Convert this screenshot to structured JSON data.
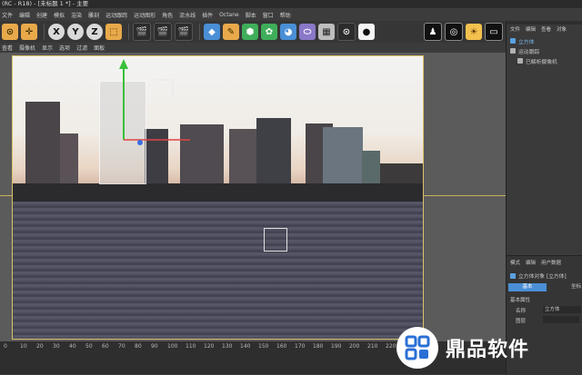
{
  "window": {
    "title": "(RC - R18) - [未标题 1 *] - 主要"
  },
  "menu": {
    "items": [
      "文件",
      "编辑",
      "创建",
      "模拟",
      "渲染",
      "雕刻",
      "运动跟踪",
      "运动图形",
      "角色",
      "流水线",
      "插件",
      "Octane",
      "脚本",
      "窗口",
      "帮助"
    ]
  },
  "toolbar": {
    "axes": [
      "X",
      "Y",
      "Z"
    ]
  },
  "viewport": {
    "menu": [
      "查看",
      "摄像机",
      "显示",
      "选项",
      "过滤",
      "面板"
    ]
  },
  "timeline": {
    "ticks": [
      "0",
      "10",
      "20",
      "30",
      "40",
      "50",
      "60",
      "70",
      "80",
      "90",
      "100",
      "110",
      "120",
      "130",
      "140",
      "150",
      "160",
      "170",
      "180",
      "190",
      "200",
      "210",
      "220"
    ]
  },
  "object_manager": {
    "tabs": [
      "文件",
      "编辑",
      "查看",
      "对象"
    ],
    "objects": [
      {
        "name": "立方体",
        "color": "#5aa0e0"
      },
      {
        "name": "运动跟踪",
        "color": "#b0b0b0"
      },
      {
        "name": "已解析摄像机",
        "color": "#b0b0b0"
      }
    ]
  },
  "attributes": {
    "tabs": [
      "模式",
      "编辑",
      "用户数据"
    ],
    "title": "立方体对象 [立方体]",
    "sub_tabs": [
      "基本",
      "坐标"
    ],
    "section": "基本属性",
    "name_label": "名称",
    "name_value": "立方体",
    "layer_label": "图层"
  },
  "watermark": {
    "text": "鼎品软件"
  },
  "colors": {
    "accent": "#d8c36a",
    "selected": "#4a8fd6"
  }
}
